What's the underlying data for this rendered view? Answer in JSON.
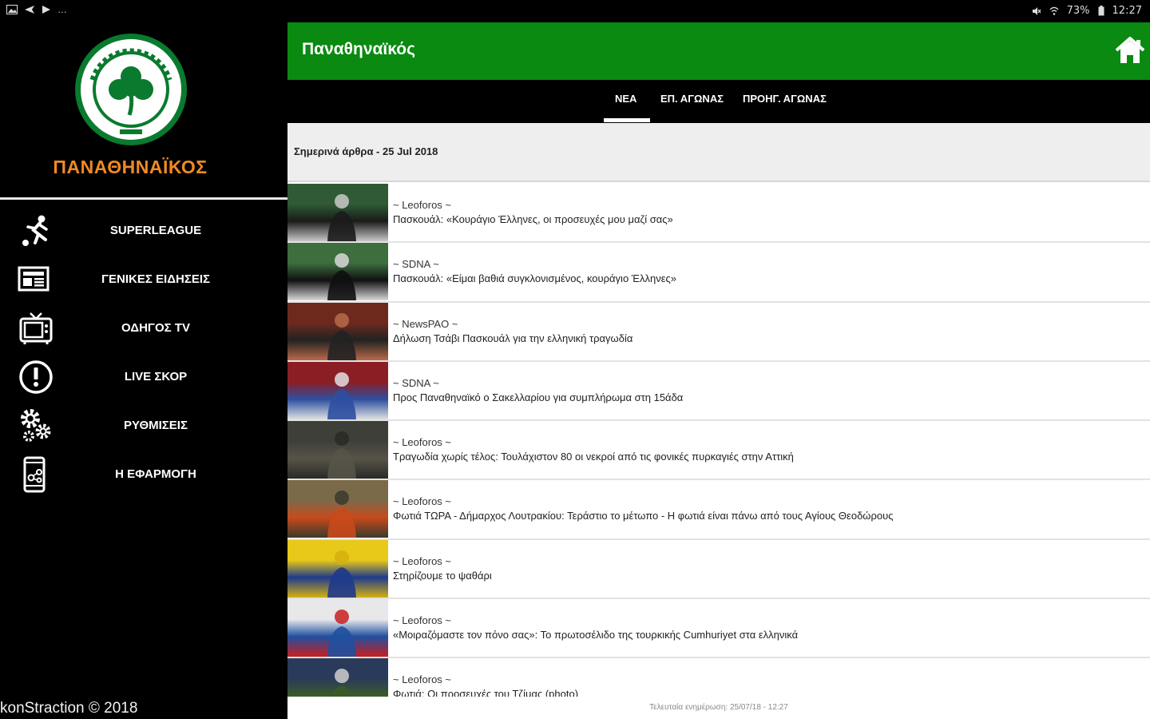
{
  "status_bar": {
    "battery": "73%",
    "time": "12:27"
  },
  "drawer": {
    "club_name": "ΠΑΝΑΘΗΝΑΪΚΟΣ",
    "menu": [
      {
        "label": "SUPERLEAGUE",
        "icon": "player-kick-icon"
      },
      {
        "label": "ΓΕΝΙΚΕΣ ΕΙΔΗΣΕΙΣ",
        "icon": "newspaper-icon"
      },
      {
        "label": "ΟΔΗΓΟΣ TV",
        "icon": "tv-icon"
      },
      {
        "label": "LIVE ΣΚΟΡ",
        "icon": "alert-circle-icon"
      },
      {
        "label": "ΡΥΘΜΙΣΕΙΣ",
        "icon": "gears-icon"
      },
      {
        "label": "Η ΕΦΑΡΜΟΓΗ",
        "icon": "phone-app-icon"
      }
    ],
    "copyright": "konStraction © 2018"
  },
  "appbar": {
    "title": "Παναθηναϊκός",
    "home_icon": "home-icon"
  },
  "tabs": [
    {
      "label": "ΝΕΑ",
      "selected": true
    },
    {
      "label": "ΕΠ. ΑΓΩΝΑΣ",
      "selected": false
    },
    {
      "label": "ΠΡΟΗΓ. ΑΓΩΝΑΣ",
      "selected": false
    }
  ],
  "section_header": "Σημερινά άρθρα - 25 Jul 2018",
  "articles": [
    {
      "source": "~ Leoforos ~",
      "title": "Πασκουάλ: «Κουράγιο Έλληνες, οι προσευχές μου μαζί σας»",
      "thumb_colors": [
        "#2f5a34",
        "#1b1b1b",
        "#c9c9c9"
      ]
    },
    {
      "source": "~ SDNA ~",
      "title": "Πασκουάλ: «Είμαι βαθιά συγκλονισμένος, κουράγιο Έλληνες»",
      "thumb_colors": [
        "#3c6e3e",
        "#101010",
        "#d8d8d8"
      ]
    },
    {
      "source": "~ NewsPAO ~",
      "title": "Δήλωση Τσάβι Πασκουάλ για την ελληνική τραγωδία",
      "thumb_colors": [
        "#6d2a1c",
        "#222222",
        "#b86a4a"
      ]
    },
    {
      "source": "~ SDNA ~",
      "title": "Προς Παναθηναϊκό ο Σακελλαρίου για συμπλήρωμα στη 15άδα",
      "thumb_colors": [
        "#8a1e24",
        "#2d4fa0",
        "#e0e0e0"
      ]
    },
    {
      "source": "~ Leoforos ~",
      "title": "Τραγωδία χωρίς τέλος: Τουλάχιστον 80 οι νεκροί από τις φονικές πυρκαγιές στην Αττική",
      "thumb_colors": [
        "#3f3f3a",
        "#575348",
        "#2a2a26"
      ]
    },
    {
      "source": "~ Leoforos ~",
      "title": "Φωτιά ΤΩΡΑ - Δήμαρχος Λουτρακίου: Τεράστιο το μέτωπο - Η φωτιά είναι πάνω από τους Αγίους Θεοδώρους",
      "thumb_colors": [
        "#7b6a4a",
        "#c84a1c",
        "#3a3a2a"
      ]
    },
    {
      "source": "~ Leoforos ~",
      "title": "Στηρίζουμε το ψαθάρι",
      "thumb_colors": [
        "#e8c818",
        "#1e3a8c",
        "#d6b010"
      ]
    },
    {
      "source": "~ Leoforos ~",
      "title": "«Μοιραζόμαστε τον πόνο σας»: Το πρωτοσέλιδο της τουρκικής Cumhuriyet στα ελληνικά",
      "thumb_colors": [
        "#e8e8ea",
        "#2050a0",
        "#c81e1e"
      ]
    },
    {
      "source": "~ Leoforos ~",
      "title": "Φωτιά: Οι προσευχές του Τζίμας (photo)",
      "thumb_colors": [
        "#2a3a5a",
        "#3a5a2a",
        "#cfcfcf"
      ]
    }
  ],
  "footer": "Τελευταία ενημέρωση: 25/07/18 - 12:27",
  "colors": {
    "appbar": "#0a8a10",
    "accent_orange": "#f08a24",
    "drawer_bg": "#000000"
  }
}
